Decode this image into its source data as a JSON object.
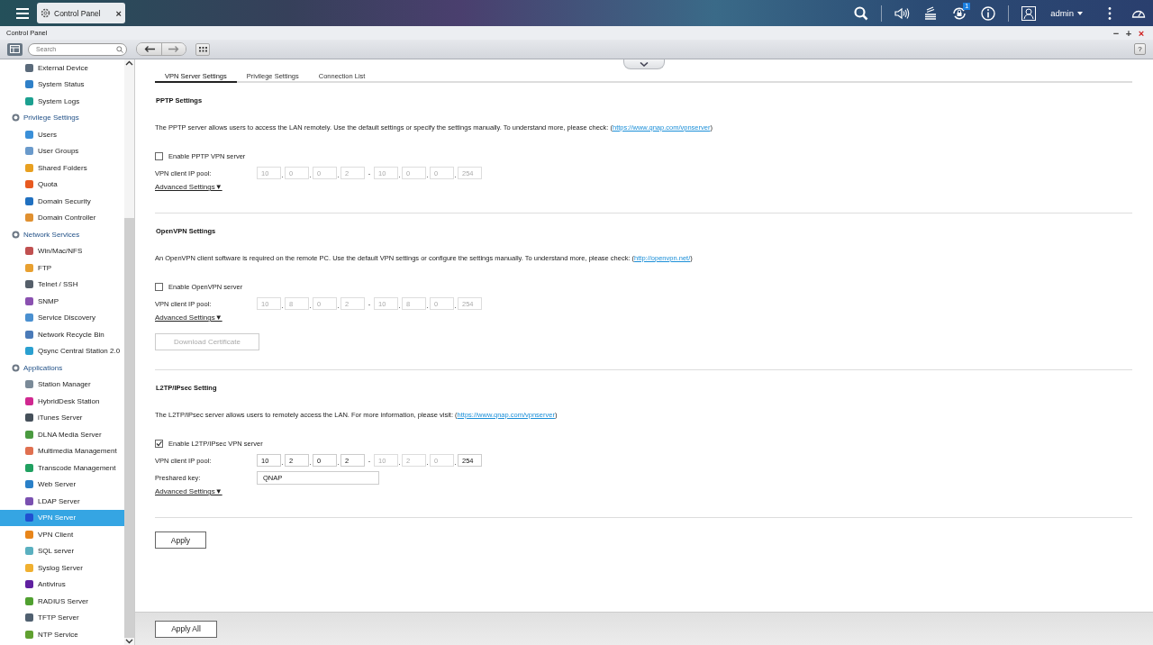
{
  "top_bar": {
    "app_tab": {
      "title": "Control Panel",
      "close": "×"
    },
    "notification_count": "1",
    "user": "admin"
  },
  "window": {
    "title": "Control Panel",
    "controls": [
      "−",
      "+",
      "×"
    ],
    "help": "?"
  },
  "toolbar": {
    "search": {
      "placeholder": "Search"
    }
  },
  "sidebar": {
    "groups": [
      {
        "items": [
          {
            "label": "External Device",
            "selected": false
          },
          {
            "label": "System Status",
            "selected": false
          },
          {
            "label": "System Logs",
            "selected": false
          }
        ]
      },
      {
        "label": "Privilege Settings",
        "items": [
          {
            "label": "Users",
            "selected": false
          },
          {
            "label": "User Groups",
            "selected": false
          },
          {
            "label": "Shared Folders",
            "selected": false
          },
          {
            "label": "Quota",
            "selected": false
          },
          {
            "label": "Domain Security",
            "selected": false
          },
          {
            "label": "Domain Controller",
            "selected": false
          }
        ]
      },
      {
        "label": "Network Services",
        "items": [
          {
            "label": "Win/Mac/NFS",
            "selected": false
          },
          {
            "label": "FTP",
            "selected": false
          },
          {
            "label": "Telnet / SSH",
            "selected": false
          },
          {
            "label": "SNMP",
            "selected": false
          },
          {
            "label": "Service Discovery",
            "selected": false
          },
          {
            "label": "Network Recycle Bin",
            "selected": false
          },
          {
            "label": "Qsync Central Station 2.0",
            "selected": false
          }
        ]
      },
      {
        "label": "Applications",
        "items": [
          {
            "label": "Station Manager",
            "selected": false
          },
          {
            "label": "HybridDesk Station",
            "selected": false
          },
          {
            "label": "iTunes Server",
            "selected": false
          },
          {
            "label": "DLNA Media Server",
            "selected": false
          },
          {
            "label": "Multimedia Management",
            "selected": false
          },
          {
            "label": "Transcode Management",
            "selected": false
          },
          {
            "label": "Web Server",
            "selected": false
          },
          {
            "label": "LDAP Server",
            "selected": false
          },
          {
            "label": "VPN Server",
            "selected": true
          },
          {
            "label": "VPN Client",
            "selected": false
          },
          {
            "label": "SQL server",
            "selected": false
          },
          {
            "label": "Syslog Server",
            "selected": false
          },
          {
            "label": "Antivirus",
            "selected": false
          },
          {
            "label": "RADIUS Server",
            "selected": false
          },
          {
            "label": "TFTP Server",
            "selected": false
          },
          {
            "label": "NTP Service",
            "selected": false
          }
        ]
      }
    ]
  },
  "tabs": [
    {
      "label": "VPN Server Settings",
      "selected": true
    },
    {
      "label": "Privilege Settings",
      "selected": false
    },
    {
      "label": "Connection List",
      "selected": false
    }
  ],
  "sections": [
    {
      "title": "PPTP Settings",
      "description": "The PPTP server allows users to access the LAN remotely. Use the default settings or specify the settings manually. To understand more, please check: (",
      "link": "https://www.qnap.com/vpnserver",
      "description_end": ")",
      "checkbox": {
        "label": "Enable PPTP VPN server",
        "checked": false
      },
      "fields": [
        {
          "kind": "ip_pool",
          "label": "VPN client IP pool:",
          "separator": "-",
          "start": [
            {
              "value": "10",
              "disabled": true
            },
            {
              "value": "0",
              "disabled": true
            },
            {
              "value": "0",
              "disabled": true
            },
            {
              "value": "2",
              "disabled": true
            }
          ],
          "end": [
            {
              "value": "10",
              "disabled": true
            },
            {
              "value": "0",
              "disabled": true
            },
            {
              "value": "0",
              "disabled": true
            },
            {
              "value": "254",
              "disabled": true
            }
          ]
        }
      ],
      "advanced": "Advanced Settings▼"
    },
    {
      "title": "OpenVPN Settings",
      "description": "An OpenVPN client software is required on the remote PC. Use the default VPN settings or configure the settings manually. To understand more, please check: (",
      "link": "http://openvpn.net/",
      "description_end": ")",
      "checkbox": {
        "label": "Enable OpenVPN server",
        "checked": false
      },
      "fields": [
        {
          "kind": "ip_pool",
          "label": "VPN client IP pool:",
          "separator": "-",
          "start": [
            {
              "value": "10",
              "disabled": true
            },
            {
              "value": "8",
              "disabled": true
            },
            {
              "value": "0",
              "disabled": true
            },
            {
              "value": "2",
              "disabled": true
            }
          ],
          "end": [
            {
              "value": "10",
              "disabled": true
            },
            {
              "value": "8",
              "disabled": true
            },
            {
              "value": "0",
              "disabled": true
            },
            {
              "value": "254",
              "disabled": true
            }
          ]
        }
      ],
      "advanced": "Advanced Settings▼",
      "button": {
        "label": "Download Certificate",
        "disabled": true
      }
    },
    {
      "title": "L2TP/IPsec Setting",
      "description": "The L2TP/IPsec server allows users to remotely access the LAN. For more information, please visit: (",
      "link": "https://www.qnap.com/vpnserver",
      "description_end": ")",
      "checkbox": {
        "label": "Enable L2TP/IPsec VPN server",
        "checked": true
      },
      "fields": [
        {
          "kind": "ip_pool",
          "label": "VPN client IP pool:",
          "separator": "-",
          "start": [
            {
              "value": "10",
              "disabled": false
            },
            {
              "value": "2",
              "disabled": false
            },
            {
              "value": "0",
              "disabled": false
            },
            {
              "value": "2",
              "disabled": false
            }
          ],
          "end": [
            {
              "value": "10",
              "disabled": true
            },
            {
              "value": "2",
              "disabled": true
            },
            {
              "value": "0",
              "disabled": true
            },
            {
              "value": "254",
              "disabled": false
            }
          ]
        },
        {
          "kind": "text",
          "label": "Preshared key:",
          "value": "QNAP"
        }
      ],
      "advanced": "Advanced Settings▼"
    }
  ],
  "apply": "Apply",
  "footer": {
    "apply_all": "Apply All"
  }
}
